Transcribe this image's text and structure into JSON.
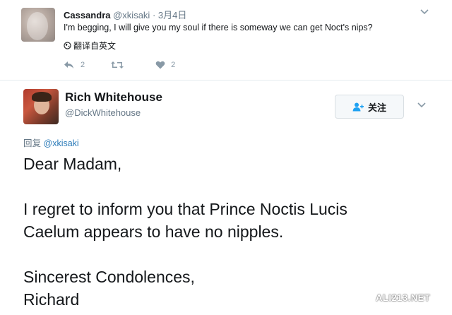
{
  "reply_tweet": {
    "name": "Cassandra",
    "handle": "@xkisaki",
    "separator": "·",
    "date": "3月4日",
    "text": "I'm begging, I will give you my soul if there is someway we can get Noct's nips?",
    "translate_label": "翻译自英文",
    "actions": {
      "reply_count": "2",
      "retweet_count": "",
      "like_count": "2"
    }
  },
  "main_tweet": {
    "name": "Rich Whitehouse",
    "handle": "@DickWhitehouse",
    "follow_label": "关注",
    "replying_label": "回复",
    "replying_mention": "@xkisaki",
    "body": {
      "line1": "Dear Madam,",
      "line2": "I regret to inform you that Prince Noctis Lucis",
      "line3": "Caelum appears to have no nipples.",
      "line4": "Sincerest Condolences,",
      "line5": "Richard"
    }
  },
  "watermark": "ALI213.NET",
  "colors": {
    "link": "#2b7bb9",
    "muted": "#657786",
    "icon": "#8899a6"
  }
}
